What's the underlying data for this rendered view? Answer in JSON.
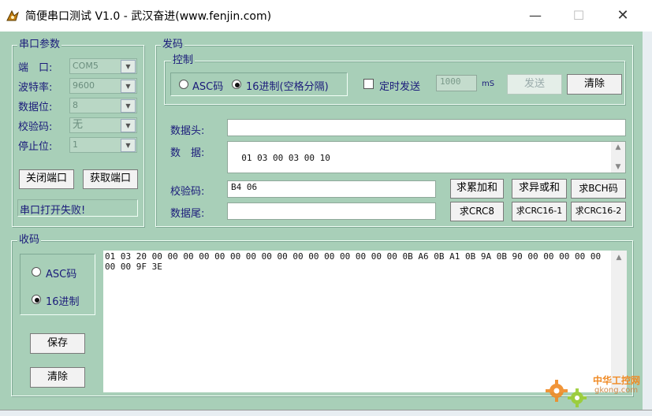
{
  "window": {
    "title": "简便串口测试 V1.0 - 武汉奋进(www.fenjin.com)",
    "min": "—",
    "max": "☐",
    "close": "✕"
  },
  "serial": {
    "title": "串口参数",
    "port_label": "端　口:",
    "port_value": "COM5",
    "baud_label": "波特率:",
    "baud_value": "9600",
    "databits_label": "数据位:",
    "databits_value": "8",
    "parity_label": "校验码:",
    "parity_value": "无",
    "stopbits_label": "停止位:",
    "stopbits_value": "1",
    "close_btn": "关闭端口",
    "get_btn": "获取端口",
    "status": "串口打开失败!"
  },
  "send": {
    "title": "发码",
    "control_title": "控制",
    "mode_asc": "ASC码",
    "mode_hex": "16进制(空格分隔)",
    "mode_selected": "hex",
    "timer_label": "定时发送",
    "timer_checked": false,
    "interval": "1000",
    "interval_unit": "mS",
    "send_btn": "发送",
    "clear_btn": "清除",
    "header_label": "数据头:",
    "header_value": "",
    "data_label": "数　据:",
    "data_value": "01 03 00 03 00 10",
    "check_label": "校验码:",
    "check_value": "B4 06",
    "tail_label": "数据尾:",
    "tail_value": "",
    "btn_sum": "求累加和",
    "btn_xor": "求异或和",
    "btn_bch": "求BCH码",
    "btn_crc8": "求CRC8",
    "btn_crc16_1": "求CRC16-1",
    "btn_crc16_2": "求CRC16-2"
  },
  "recv": {
    "title": "收码",
    "mode_asc": "ASC码",
    "mode_hex": "16进制",
    "mode_selected": "hex",
    "save_btn": "保存",
    "clear_btn": "清除",
    "text": "01 03 20 00 00 00 00 00 00 00 00 00 00 00 00 00 00 00 00 0B A6 0B A1 0B 9A 0B 90 00 00 00 00 00 00 00 9F 3E"
  },
  "watermark": {
    "cn": "中华工控网",
    "url": "gkong.com"
  },
  "colors": {
    "bg": "#a8cfb8",
    "label": "#1a1a7a",
    "watermark": "#f08a24"
  }
}
